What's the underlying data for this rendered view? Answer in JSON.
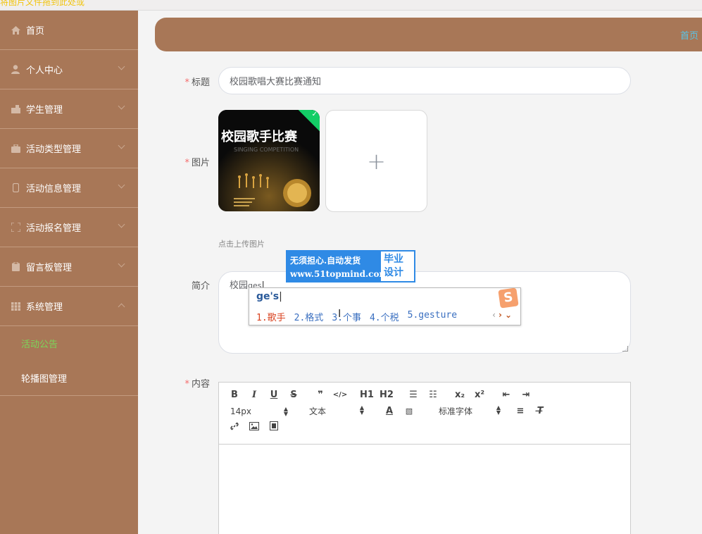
{
  "top_strip": "将图片文件拖到此处或",
  "sidebar": {
    "items": [
      {
        "label": "首页",
        "icon": "home-icon"
      },
      {
        "label": "个人中心",
        "icon": "user-icon"
      },
      {
        "label": "学生管理",
        "icon": "student-icon"
      },
      {
        "label": "活动类型管理",
        "icon": "briefcase-icon"
      },
      {
        "label": "活动信息管理",
        "icon": "phone-icon"
      },
      {
        "label": "活动报名管理",
        "icon": "scan-icon"
      },
      {
        "label": "留言板管理",
        "icon": "clipboard-icon"
      },
      {
        "label": "系统管理",
        "icon": "grid-icon"
      }
    ],
    "sub_items": [
      {
        "label": "活动公告"
      },
      {
        "label": "轮播图管理"
      }
    ]
  },
  "header": {
    "breadcrumb": "首页"
  },
  "form": {
    "title_label": "标题",
    "title_value": "校园歌唱大赛比赛通知",
    "image_label": "图片",
    "image_caption": "校园歌手比赛",
    "image_subcaption": "SINGING COMPETITION",
    "upload_plus": "+",
    "upload_tip": "点击上传图片",
    "intro_label": "简介",
    "intro_value": "校园",
    "intro_composition": "ges",
    "content_label": "内容",
    "required_mark": "*"
  },
  "editor": {
    "row1": [
      "B",
      "I",
      "U",
      "S",
      "❞",
      "</>",
      "H1",
      "H2",
      "☰",
      "☷",
      "x₂",
      "x²",
      "⇤",
      "⇥"
    ],
    "font_size": "14px",
    "block_type": "文本",
    "font_family": "标准字体"
  },
  "ad": {
    "line1": "无须担心.自动发货",
    "line2": "www.51topmind.com",
    "right1": "毕业",
    "right2": "设计"
  },
  "ime": {
    "input": "ge's",
    "logo": "S",
    "candidates": [
      "1.歌手",
      "2.格式",
      "3.个事",
      "4.个税",
      "5.gesture"
    ]
  }
}
